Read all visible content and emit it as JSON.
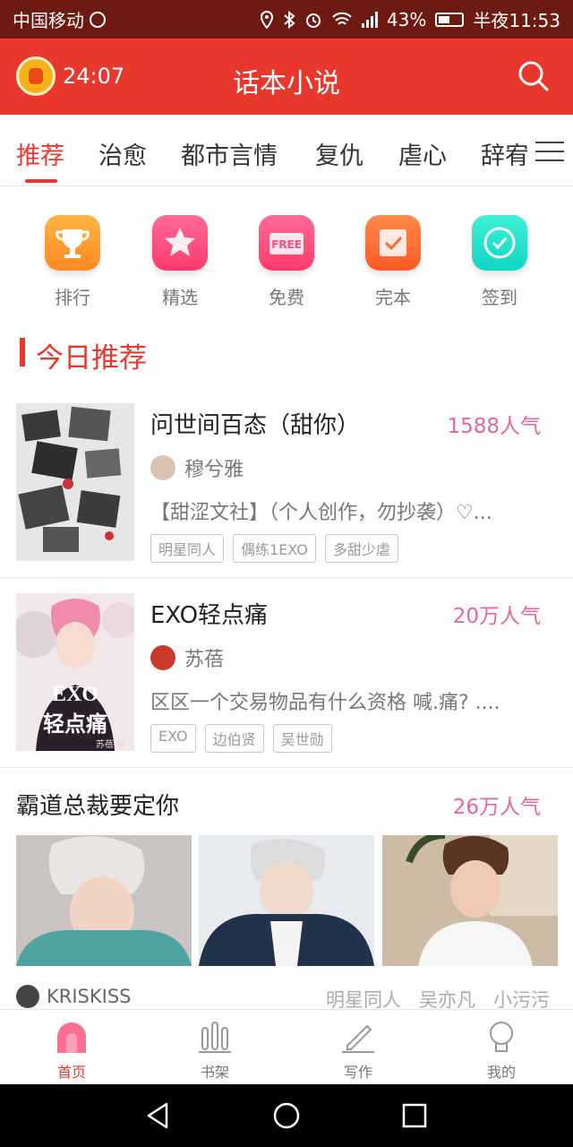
{
  "status_bar": {
    "carrier": "中国移动",
    "battery": "43%",
    "time": "半夜11:53"
  },
  "header": {
    "timer": "24:07",
    "title": "话本小说",
    "icons": {
      "timer": "alarm-clock-icon",
      "search": "search-icon"
    }
  },
  "tabs": [
    "推荐",
    "治愈",
    "都市言情",
    "复仇",
    "虐心",
    "辞宥"
  ],
  "quick_links": [
    {
      "label": "排行",
      "icon": "trophy-icon",
      "color": "#ff9a2e"
    },
    {
      "label": "精选",
      "icon": "star-icon",
      "color": "#ff4b7a"
    },
    {
      "label": "免费",
      "icon": "free-icon",
      "color": "#ff4b7a"
    },
    {
      "label": "完本",
      "icon": "checkbox-icon",
      "color": "#ff6a33"
    },
    {
      "label": "签到",
      "icon": "signin-icon",
      "color": "#1ee0c8"
    }
  ],
  "section": {
    "title": "今日推荐"
  },
  "books": [
    {
      "title": "问世间百态（甜你）",
      "popularity": "1588人气",
      "author": "穆兮雅",
      "description": "【甜涩文社】（个人创作，勿抄袭）♡...",
      "tags": [
        "明星同人",
        "偶练1EXO",
        "多甜少虐"
      ]
    },
    {
      "title": "EXO轻点痛",
      "popularity": "20万人气",
      "author": "苏蓓",
      "description": "区区一个交易物品有什么资格  喊.痛?  ....",
      "tags": [
        "EXO",
        "边伯贤",
        "吴世勋"
      ],
      "cover_text": {
        "line1": "EXO",
        "line2": "轻点痛",
        "byline": "苏蓓 著"
      }
    }
  ],
  "collection": {
    "title": "霸道总裁要定你",
    "popularity": "26万人气",
    "author": "KRISKISS",
    "tags": [
      "明星同人",
      "吴亦凡",
      "小污污"
    ]
  },
  "bottom_nav": [
    {
      "label": "首页",
      "icon": "home-icon"
    },
    {
      "label": "书架",
      "icon": "bookshelf-icon"
    },
    {
      "label": "写作",
      "icon": "pencil-icon"
    },
    {
      "label": "我的",
      "icon": "profile-icon"
    }
  ],
  "colors": {
    "brand_red": "#e8372d",
    "popularity_pink": "#e8659b",
    "status_bar": "#6d1a12"
  }
}
